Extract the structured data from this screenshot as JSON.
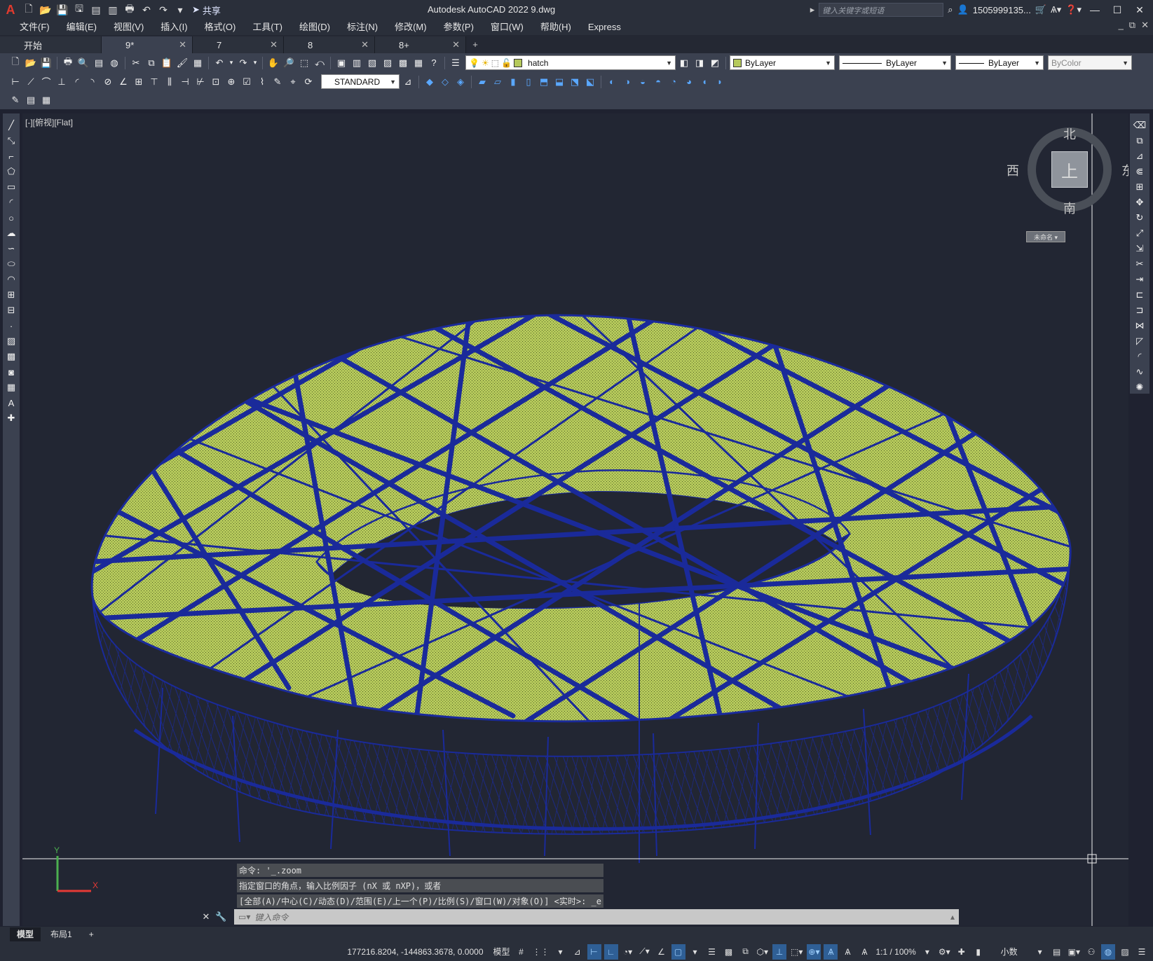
{
  "app": {
    "logo": "A",
    "title": "Autodesk AutoCAD 2022    9.dwg",
    "share_label": "共享",
    "search_placeholder": "键入关键字或短语",
    "user": "1505999135...",
    "window_controls": [
      "minimize-icon",
      "maximize-icon",
      "close-icon"
    ]
  },
  "menu": [
    "文件(F)",
    "编辑(E)",
    "视图(V)",
    "插入(I)",
    "格式(O)",
    "工具(T)",
    "绘图(D)",
    "标注(N)",
    "修改(M)",
    "参数(P)",
    "窗口(W)",
    "帮助(H)",
    "Express"
  ],
  "tabs": [
    {
      "label": "开始",
      "closable": false
    },
    {
      "label": "9*",
      "closable": true,
      "active": true
    },
    {
      "label": "7",
      "closable": true
    },
    {
      "label": "8",
      "closable": true
    },
    {
      "label": "8+",
      "closable": true
    }
  ],
  "toolbar": {
    "layer_name": "hatch",
    "color": "ByLayer",
    "linetype": "ByLayer",
    "lineweight": "ByLayer",
    "plotstyle": "ByColor",
    "text_style": "STANDARD"
  },
  "viewport": {
    "label": "[-][俯视][Flat]",
    "compass": {
      "north": "北",
      "south": "南",
      "east": "东",
      "west": "西",
      "face": "上"
    },
    "wcs_label": "未命名 ▾",
    "ucs_y": "Y",
    "ucs_x": "X"
  },
  "command": {
    "history": [
      "命令: '_.zoom",
      "指定窗口的角点，输入比例因子 (nX 或 nXP)，或者",
      "[全部(A)/中心(C)/动态(D)/范围(E)/上一个(P)/比例(S)/窗口(W)/对象(O)] <实时>: _e"
    ],
    "placeholder": "键入命令"
  },
  "layout_tabs": [
    "模型",
    "布局1"
  ],
  "status": {
    "coords": "177216.8204, -144863.3678, 0.0000",
    "model": "模型",
    "scale": "1:1 / 100%",
    "units": "小数"
  },
  "colors": {
    "background": "#222633",
    "structure": "#1a2a9a",
    "hatch": "#b5c95b",
    "ui_panel": "#3b4150"
  }
}
